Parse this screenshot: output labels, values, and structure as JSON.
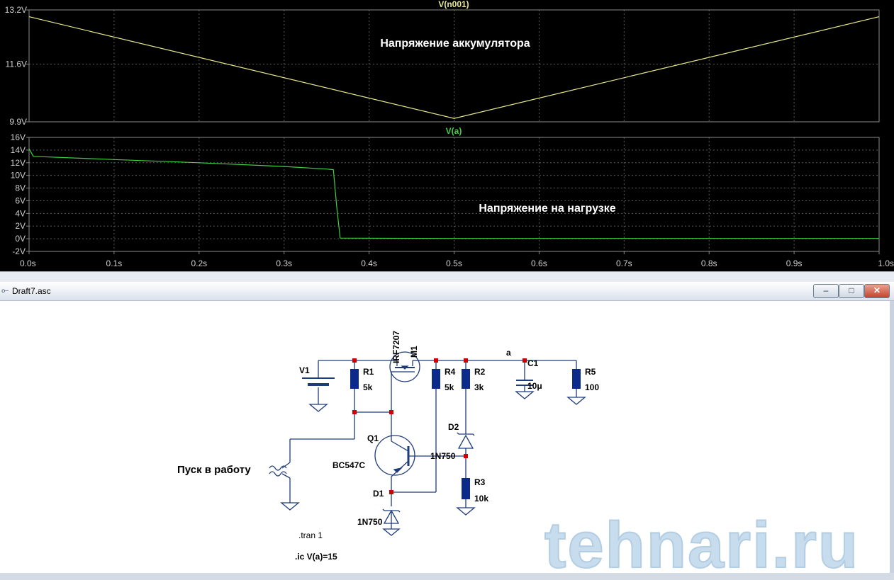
{
  "waveform": {
    "top_plot": {
      "trace_name": "V(n001)",
      "y_ticks": [
        "13.2V",
        "11.6V",
        "9.9V"
      ],
      "annotation": "Напряжение аккумулятора",
      "trace_color": "#e8e88c"
    },
    "bottom_plot": {
      "trace_name": "V(a)",
      "y_ticks": [
        "16V",
        "14V",
        "12V",
        "10V",
        "8V",
        "6V",
        "4V",
        "2V",
        "0V",
        "-2V"
      ],
      "annotation": "Напряжение на  нагрузке",
      "trace_color": "#3fd23f"
    },
    "x_ticks": [
      "0.0s",
      "0.1s",
      "0.2s",
      "0.3s",
      "0.4s",
      "0.5s",
      "0.6s",
      "0.7s",
      "0.8s",
      "0.9s",
      "1.0s"
    ]
  },
  "chart_data": [
    {
      "type": "line",
      "title": "V(n001)",
      "xlim": [
        0,
        1.0
      ],
      "ylim": [
        9.9,
        13.2
      ],
      "grid": true,
      "series": [
        {
          "name": "V(n001)",
          "x": [
            0.0,
            0.5,
            1.0
          ],
          "y": [
            13.0,
            10.0,
            13.0
          ]
        }
      ]
    },
    {
      "type": "line",
      "title": "V(a)",
      "xlim": [
        0,
        1.0
      ],
      "ylim": [
        -2,
        16
      ],
      "grid": true,
      "series": [
        {
          "name": "V(a)",
          "x": [
            0.0,
            0.005,
            0.1,
            0.2,
            0.3,
            0.35,
            0.358,
            0.362,
            0.366,
            0.5,
            1.0
          ],
          "y": [
            14.2,
            13.0,
            12.5,
            12.0,
            11.4,
            11.0,
            10.9,
            5.0,
            0.1,
            0.05,
            0.05
          ]
        }
      ]
    }
  ],
  "window": {
    "title": "Draft7.asc",
    "minimize": "–",
    "maximize": "□",
    "close": "✕"
  },
  "schematic": {
    "components": {
      "v1": "V1",
      "r1": "R1",
      "r1_val": "5k",
      "m1": "M1",
      "m1_model": "IRF7207",
      "r4": "R4",
      "r4_val": "5k",
      "r2": "R2",
      "r2_val": "3k",
      "c1": "C1",
      "c1_val": "10μ",
      "r5": "R5",
      "r5_val": "100",
      "q1": "Q1",
      "q1_model": "BC547C",
      "d1": "D1",
      "d1_model": "1N750",
      "d2": "D2",
      "d2_model": "1N750",
      "r3": "R3",
      "r3_val": "10k",
      "net_a": "a"
    },
    "start_label": "Пуск в работу",
    "directive_tran": ".tran 1",
    "directive_ic": ".ic V(a)=15",
    "watermark": "tehnari.ru"
  }
}
